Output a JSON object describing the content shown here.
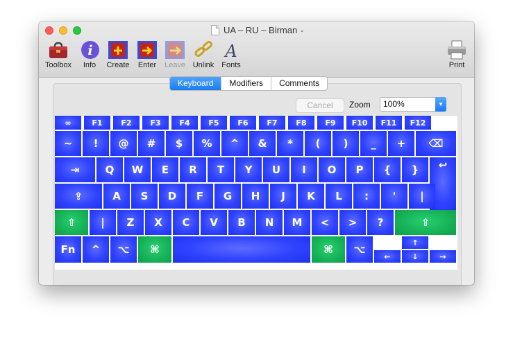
{
  "window": {
    "title": "UA – RU – Birman",
    "title_chevron": "⌄"
  },
  "toolbar": [
    {
      "label": "Toolbox",
      "icon": "toolbox-icon",
      "enabled": true
    },
    {
      "label": "Info",
      "icon": "info-icon",
      "enabled": true
    },
    {
      "label": "Create",
      "icon": "create-icon",
      "enabled": true
    },
    {
      "label": "Enter",
      "icon": "enter-icon",
      "enabled": true
    },
    {
      "label": "Leave",
      "icon": "leave-icon",
      "enabled": false
    },
    {
      "label": "Unlink",
      "icon": "unlink-icon",
      "enabled": true
    },
    {
      "label": "Fonts",
      "icon": "fonts-icon",
      "enabled": true
    },
    {
      "label": "Print",
      "icon": "printer-icon",
      "enabled": true
    }
  ],
  "tabs": [
    {
      "label": "Keyboard",
      "active": true
    },
    {
      "label": "Modifiers",
      "active": false
    },
    {
      "label": "Comments",
      "active": false
    }
  ],
  "controls": {
    "cancel_label": "Cancel",
    "zoom_label": "Zoom",
    "zoom_value": "100%"
  },
  "colors": {
    "key_blue": "#2f43ff",
    "key_green": "#16b158",
    "tab_active": "#1a7cf5"
  },
  "keyboard_rows": [
    [
      "∞",
      "F1",
      "F2",
      "F3",
      "F4",
      "F5",
      "F6",
      "F7",
      "F8",
      "F9",
      "F10",
      "F11",
      "F12"
    ],
    [
      "~",
      "!",
      "@",
      "#",
      "$",
      "%",
      "^",
      "&",
      "*",
      "(",
      ")",
      "_",
      "+",
      "⌫"
    ],
    [
      "⇥",
      "Q",
      "W",
      "E",
      "R",
      "T",
      "Y",
      "U",
      "I",
      "O",
      "P",
      "{",
      "}",
      "↩"
    ],
    [
      "⇪",
      "A",
      "S",
      "D",
      "F",
      "G",
      "H",
      "J",
      "K",
      "L",
      ":",
      "'",
      "|"
    ],
    [
      "⇧",
      "|",
      "Z",
      "X",
      "C",
      "V",
      "B",
      "N",
      "M",
      "<",
      ">",
      "?",
      "⇧"
    ],
    [
      "Fn",
      "^",
      "⌥",
      "⌘",
      "",
      "⌘",
      "⌥",
      "↑",
      "←",
      "↓",
      "→"
    ]
  ]
}
